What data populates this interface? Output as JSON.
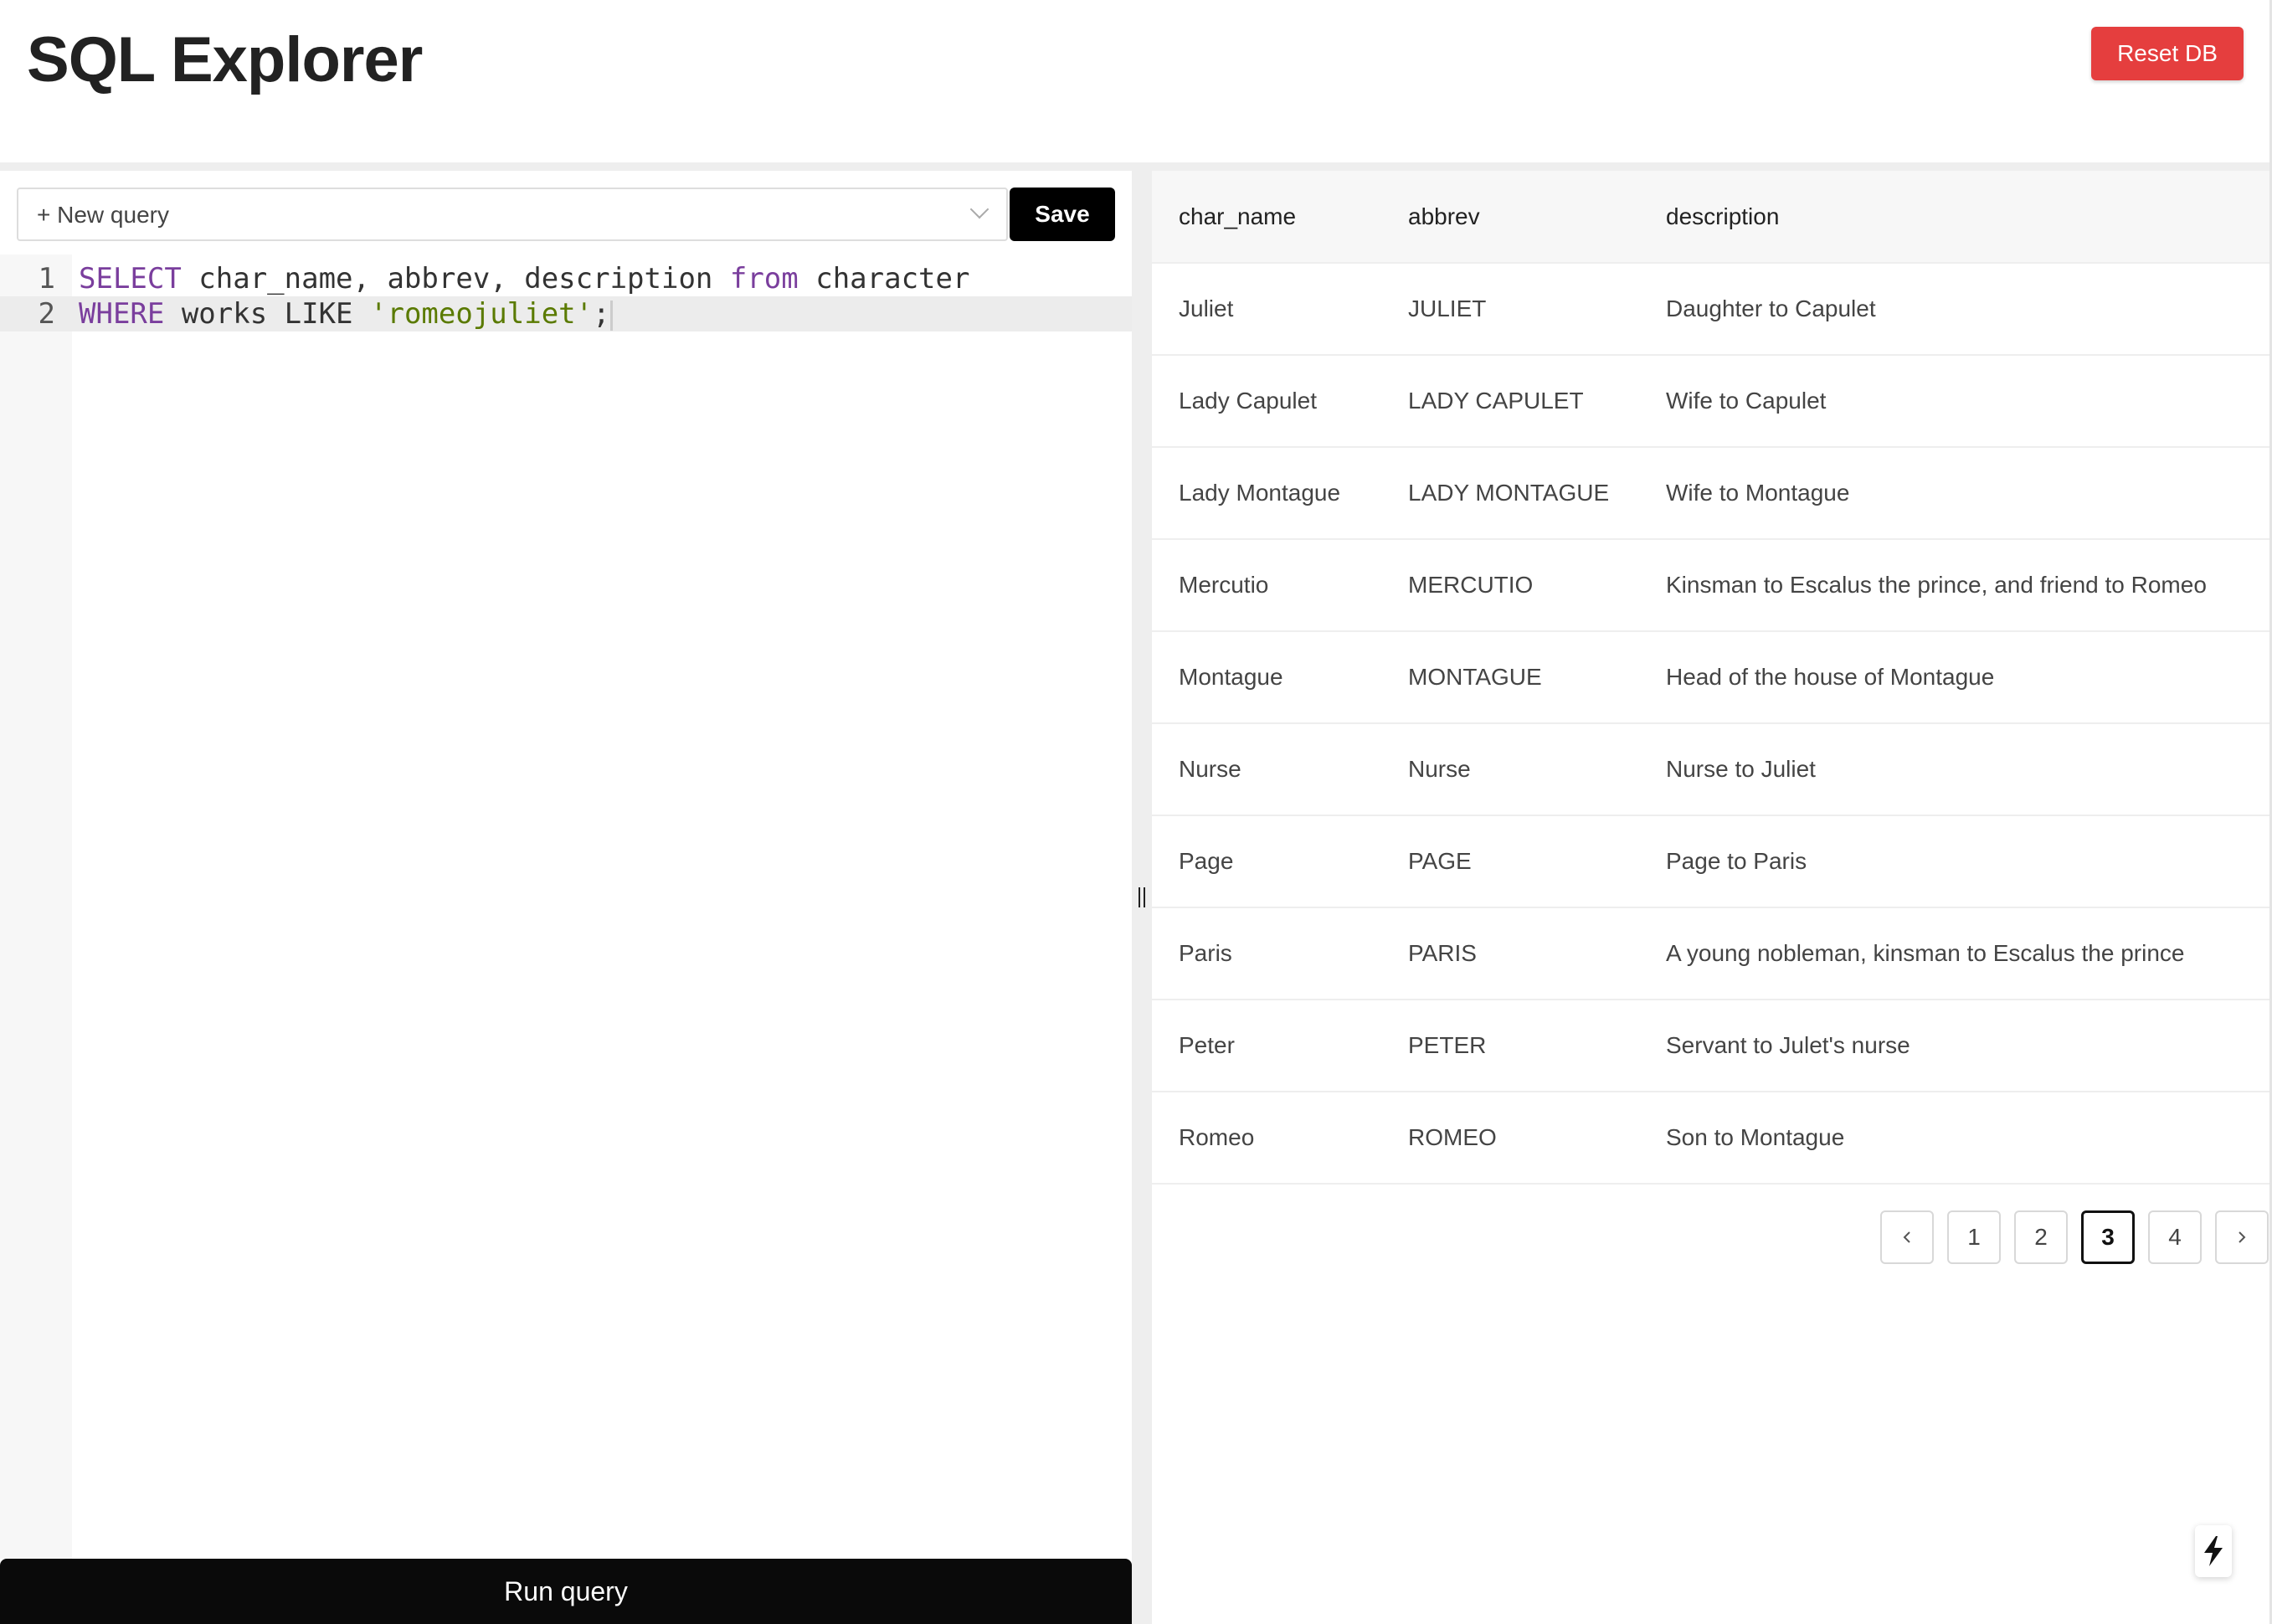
{
  "header": {
    "title": "SQL Explorer",
    "reset_label": "Reset DB"
  },
  "editor": {
    "query_select": {
      "selected": "+ New query"
    },
    "save_label": "Save",
    "lines": [
      {
        "number": "1",
        "tokens": [
          {
            "text": "SELECT",
            "kind": "keyword"
          },
          {
            "text": " char_name, abbrev, description ",
            "kind": "plain"
          },
          {
            "text": "from",
            "kind": "keyword"
          },
          {
            "text": " character",
            "kind": "plain"
          }
        ]
      },
      {
        "number": "2",
        "tokens": [
          {
            "text": "WHERE",
            "kind": "keyword"
          },
          {
            "text": " works LIKE ",
            "kind": "plain"
          },
          {
            "text": "'romeojuliet'",
            "kind": "string"
          },
          {
            "text": ";",
            "kind": "plain"
          }
        ]
      }
    ],
    "run_label": "Run query",
    "colors": {
      "keyword": "#7a3e9d",
      "string": "#5a7a00"
    }
  },
  "results": {
    "columns": [
      "char_name",
      "abbrev",
      "description"
    ],
    "rows": [
      [
        "Juliet",
        "JULIET",
        "Daughter to Capulet"
      ],
      [
        "Lady Capulet",
        "LADY CAPULET",
        "Wife to Capulet"
      ],
      [
        "Lady Montague",
        "LADY MONTAGUE",
        "Wife to Montague"
      ],
      [
        "Mercutio",
        "MERCUTIO",
        "Kinsman to Escalus the prince, and friend to Romeo"
      ],
      [
        "Montague",
        "MONTAGUE",
        "Head of the house of Montague"
      ],
      [
        "Nurse",
        "Nurse",
        "Nurse to Juliet"
      ],
      [
        "Page",
        "PAGE",
        "Page to Paris"
      ],
      [
        "Paris",
        "PARIS",
        "A young nobleman, kinsman to Escalus the prince"
      ],
      [
        "Peter",
        "PETER",
        "Servant to Julet's nurse"
      ],
      [
        "Romeo",
        "ROMEO",
        "Son to Montague"
      ]
    ],
    "pagination": {
      "prev_icon": "chevron-left-icon",
      "pages": [
        "1",
        "2",
        "3",
        "4"
      ],
      "current": "3",
      "next_icon": "chevron-right-icon"
    }
  },
  "colors": {
    "reset_button": "#e53e3e",
    "primary_button": "#000000"
  }
}
